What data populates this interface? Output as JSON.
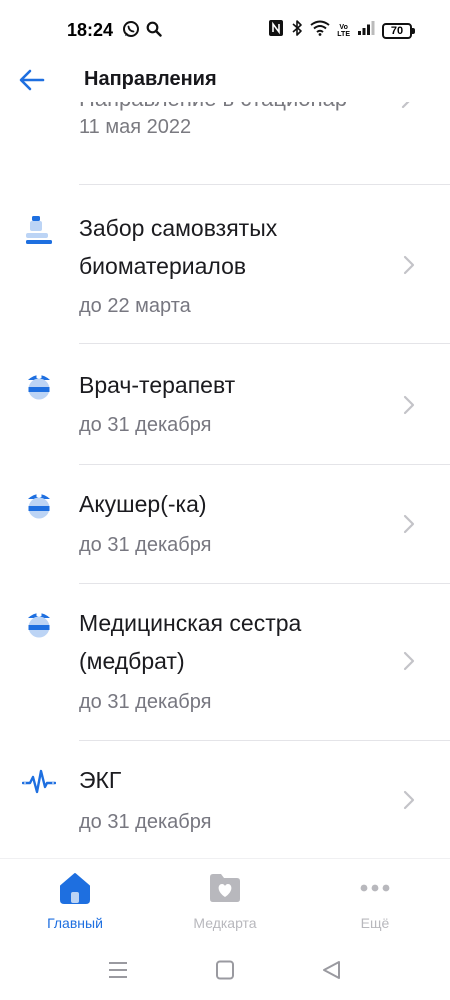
{
  "status_bar": {
    "time": "18:24",
    "left_icons": [
      "whatsapp-icon",
      "search-icon"
    ],
    "right_icons": [
      "nfc-icon",
      "bluetooth-icon",
      "wifi-icon",
      "volte-icon",
      "signal-icon",
      "battery-icon"
    ],
    "volte_top": "Vo",
    "volte_bottom": "LTE",
    "battery": "70"
  },
  "header": {
    "title": "Направления",
    "back_icon": "arrow-left-icon"
  },
  "partial_item": {
    "title": "Направление в стационар",
    "subtitle": "11 мая 2022"
  },
  "items": [
    {
      "title": "Забор самовзятых биоматериалов",
      "subtitle": "до 22 марта",
      "icon": "microscope-icon"
    },
    {
      "title": "Врач-терапевт",
      "subtitle": "до 31 декабря",
      "icon": "doctor-icon"
    },
    {
      "title": "Акушер(-ка)",
      "subtitle": "до 31 декабря",
      "icon": "doctor-icon"
    },
    {
      "title": "Медицинская сестра (медбрат)",
      "subtitle": "до 31 декабря",
      "icon": "doctor-icon"
    },
    {
      "title": "ЭКГ",
      "subtitle": "до 31 декабря",
      "icon": "ecg-icon"
    }
  ],
  "bottom_nav": [
    {
      "label": "Главный",
      "icon": "home-icon",
      "active": true
    },
    {
      "label": "Медкарта",
      "icon": "medical-card-icon",
      "active": false
    },
    {
      "label": "Ещё",
      "icon": "more-dots-icon",
      "active": false
    }
  ],
  "colors": {
    "accent": "#1e6fe0",
    "icon_light": "#bcd4f5",
    "inactive": "#b8b8bd",
    "text": "#1b1b1f",
    "secondary_text": "#777780"
  }
}
